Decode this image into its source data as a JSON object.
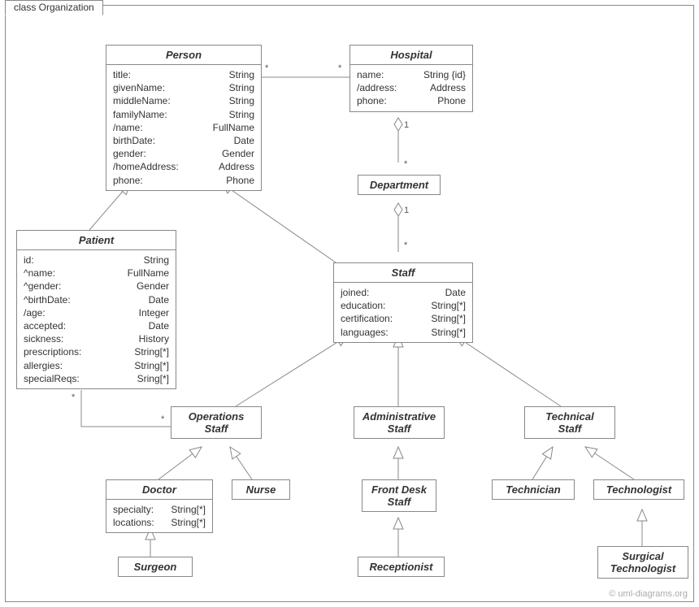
{
  "frame": {
    "title": "class Organization"
  },
  "watermark": "© uml-diagrams.org",
  "classes": {
    "person": {
      "name": "Person",
      "attrs": [
        {
          "n": "title:",
          "t": "String"
        },
        {
          "n": "givenName:",
          "t": "String"
        },
        {
          "n": "middleName:",
          "t": "String"
        },
        {
          "n": "familyName:",
          "t": "String"
        },
        {
          "n": "/name:",
          "t": "FullName"
        },
        {
          "n": "birthDate:",
          "t": "Date"
        },
        {
          "n": "gender:",
          "t": "Gender"
        },
        {
          "n": "/homeAddress:",
          "t": "Address"
        },
        {
          "n": "phone:",
          "t": "Phone"
        }
      ]
    },
    "hospital": {
      "name": "Hospital",
      "attrs": [
        {
          "n": "name:",
          "t": "String {id}"
        },
        {
          "n": "/address:",
          "t": "Address"
        },
        {
          "n": "phone:",
          "t": "Phone"
        }
      ]
    },
    "department": {
      "name": "Department",
      "attrs": []
    },
    "patient": {
      "name": "Patient",
      "attrs": [
        {
          "n": "id:",
          "t": "String"
        },
        {
          "n": "^name:",
          "t": "FullName"
        },
        {
          "n": "^gender:",
          "t": "Gender"
        },
        {
          "n": "^birthDate:",
          "t": "Date"
        },
        {
          "n": "/age:",
          "t": "Integer"
        },
        {
          "n": "accepted:",
          "t": "Date"
        },
        {
          "n": "sickness:",
          "t": "History"
        },
        {
          "n": "prescriptions:",
          "t": "String[*]"
        },
        {
          "n": "allergies:",
          "t": "String[*]"
        },
        {
          "n": "specialReqs:",
          "t": "Sring[*]"
        }
      ]
    },
    "staff": {
      "name": "Staff",
      "attrs": [
        {
          "n": "joined:",
          "t": "Date"
        },
        {
          "n": "education:",
          "t": "String[*]"
        },
        {
          "n": "certification:",
          "t": "String[*]"
        },
        {
          "n": "languages:",
          "t": "String[*]"
        }
      ]
    },
    "opstaff": {
      "name": "Operations\nStaff",
      "attrs": []
    },
    "adminstaff": {
      "name": "Administrative\nStaff",
      "attrs": []
    },
    "techstaff": {
      "name": "Technical\nStaff",
      "attrs": []
    },
    "doctor": {
      "name": "Doctor",
      "attrs": [
        {
          "n": "specialty:",
          "t": "String[*]"
        },
        {
          "n": "locations:",
          "t": "String[*]"
        }
      ]
    },
    "nurse": {
      "name": "Nurse",
      "attrs": []
    },
    "frontdesk": {
      "name": "Front Desk\nStaff",
      "attrs": []
    },
    "technician": {
      "name": "Technician",
      "attrs": []
    },
    "technologist": {
      "name": "Technologist",
      "attrs": []
    },
    "surgeon": {
      "name": "Surgeon",
      "attrs": []
    },
    "receptionist": {
      "name": "Receptionist",
      "attrs": []
    },
    "surgtech": {
      "name": "Surgical\nTechnologist",
      "attrs": []
    }
  },
  "mults": {
    "m1": "*",
    "m2": "*",
    "m3": "1",
    "m4": "*",
    "m5": "1",
    "m6": "*",
    "m7": "*",
    "m8": "*"
  }
}
